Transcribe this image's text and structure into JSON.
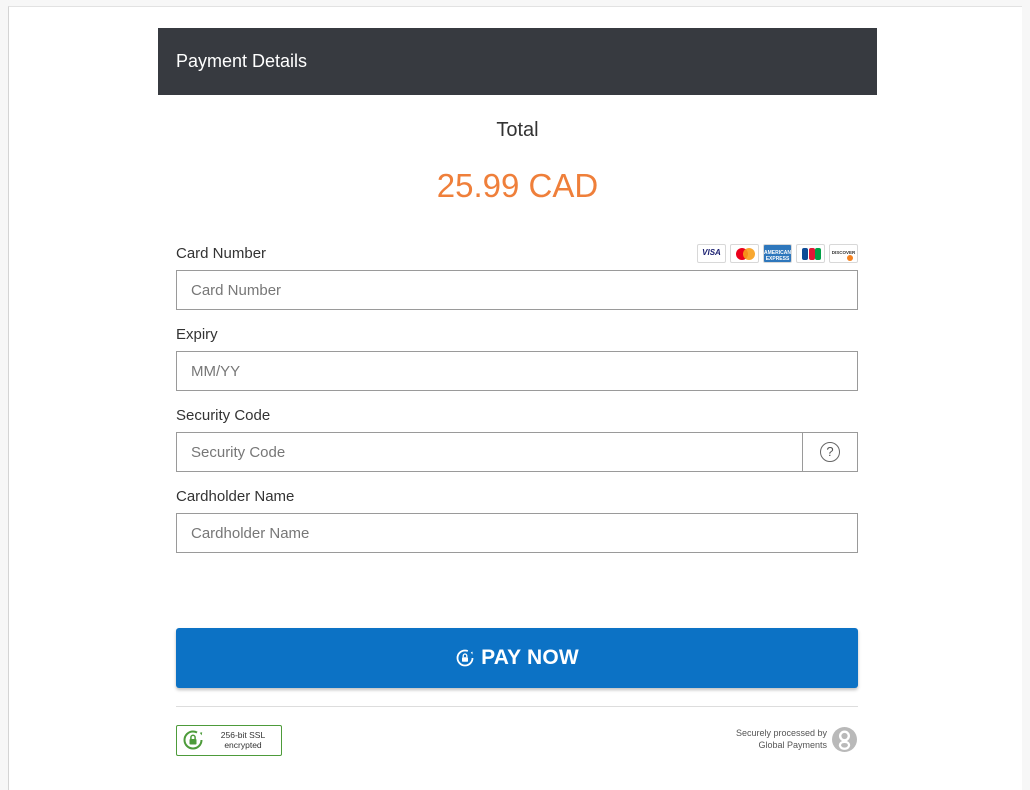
{
  "header": {
    "title": "Payment Details"
  },
  "summary": {
    "total_label": "Total",
    "amount": "25.99 CAD"
  },
  "accepted_cards": [
    {
      "name": "Visa",
      "text": "VISA",
      "icon": "visa-icon"
    },
    {
      "name": "Mastercard",
      "icon": "mastercard-icon"
    },
    {
      "name": "American Express",
      "text": "AMERICAN EXPRESS",
      "icon": "amex-icon"
    },
    {
      "name": "JCB",
      "icon": "jcb-icon"
    },
    {
      "name": "Discover",
      "text": "DISCOVER",
      "icon": "discover-icon"
    }
  ],
  "form": {
    "card_number": {
      "label": "Card Number",
      "placeholder": "Card Number",
      "value": ""
    },
    "expiry": {
      "label": "Expiry",
      "placeholder": "MM/YY",
      "value": ""
    },
    "security_code": {
      "label": "Security Code",
      "placeholder": "Security Code",
      "value": "",
      "help_icon": "question-circle-icon",
      "help_text": "?"
    },
    "cardholder_name": {
      "label": "Cardholder Name",
      "placeholder": "Cardholder Name",
      "value": ""
    }
  },
  "pay_button": {
    "label": "PAY NOW",
    "icon": "secure-lock-icon"
  },
  "footer": {
    "ssl_badge": {
      "line1": "256-bit SSL",
      "line2": "encrypted",
      "icon": "ssl-lock-icon"
    },
    "processor": {
      "line1": "Securely processed by",
      "line2": "Global Payments",
      "icon": "global-payments-logo"
    }
  },
  "colors": {
    "header_bg": "#373a40",
    "amount": "#ef7f3a",
    "pay_button": "#0c72c5",
    "ssl_green": "#4d9b3a"
  }
}
